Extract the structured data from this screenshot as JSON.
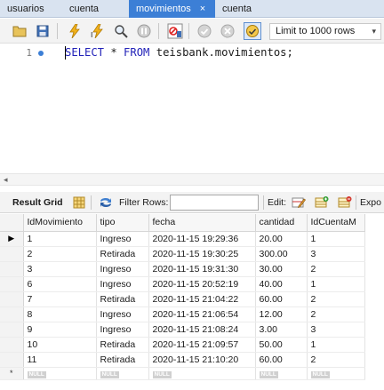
{
  "tabs": [
    {
      "label": "usuarios",
      "active": false
    },
    {
      "label": "cuenta",
      "active": false
    },
    {
      "label": "movimientos",
      "active": true
    },
    {
      "label": "cuenta",
      "active": false
    }
  ],
  "tab_close_glyph": "×",
  "toolbar": {
    "icons": [
      "open-file-icon",
      "save-icon",
      "execute-icon",
      "execute-current-icon",
      "explain-icon",
      "stop-icon",
      "toggle-output-icon",
      "commit-icon",
      "rollback-icon",
      "autocommit-icon"
    ],
    "limit_label": "Limit to 1000 rows",
    "limit_chevron": "▾"
  },
  "editor": {
    "line_number": "1",
    "kw_select": "SELECT",
    "star": " * ",
    "kw_from": "FROM",
    "rest": " teisbank.movimientos;",
    "keyword_color": "#2222b8"
  },
  "hscroll_arrow": "◂",
  "result_toolbar": {
    "result_grid_label": "Result Grid",
    "filter_rows_label": "Filter Rows:",
    "filter_value": "",
    "edit_label": "Edit:",
    "export_label": "Expo"
  },
  "grid": {
    "columns": [
      "IdMovimiento",
      "tipo",
      "fecha",
      "cantidad",
      "IdCuentaM"
    ],
    "rows": [
      [
        "1",
        "Ingreso",
        "2020-11-15 19:29:36",
        "20.00",
        "1"
      ],
      [
        "2",
        "Retirada",
        "2020-11-15 19:30:25",
        "300.00",
        "3"
      ],
      [
        "3",
        "Ingreso",
        "2020-11-15 19:31:30",
        "30.00",
        "2"
      ],
      [
        "6",
        "Ingreso",
        "2020-11-15 20:52:19",
        "40.00",
        "1"
      ],
      [
        "7",
        "Retirada",
        "2020-11-15 21:04:22",
        "60.00",
        "2"
      ],
      [
        "8",
        "Ingreso",
        "2020-11-15 21:06:54",
        "12.00",
        "2"
      ],
      [
        "9",
        "Ingreso",
        "2020-11-15 21:08:24",
        "3.00",
        "3"
      ],
      [
        "10",
        "Retirada",
        "2020-11-15 21:09:57",
        "50.00",
        "1"
      ],
      [
        "11",
        "Retirada",
        "2020-11-15 21:10:20",
        "60.00",
        "2"
      ]
    ],
    "selected_row_marker": "▶",
    "new_row_marker": "*",
    "null_label": "NULL"
  },
  "colors": {
    "accent": "#3c7fd6",
    "tabbar_bg": "#d9e3f0"
  }
}
